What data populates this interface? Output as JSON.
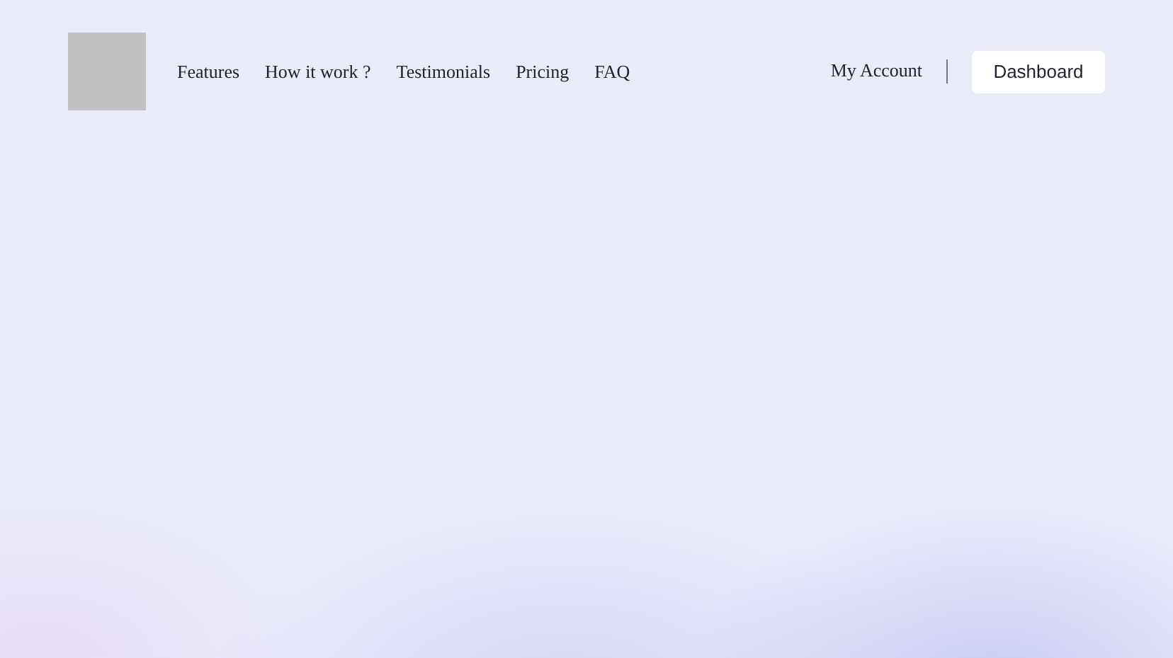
{
  "nav": {
    "links": [
      {
        "label": "Features"
      },
      {
        "label": "How it work ?"
      },
      {
        "label": "Testimonials"
      },
      {
        "label": "Pricing"
      },
      {
        "label": "FAQ"
      }
    ],
    "account_link": "My Account",
    "dashboard_button": "Dashboard"
  }
}
